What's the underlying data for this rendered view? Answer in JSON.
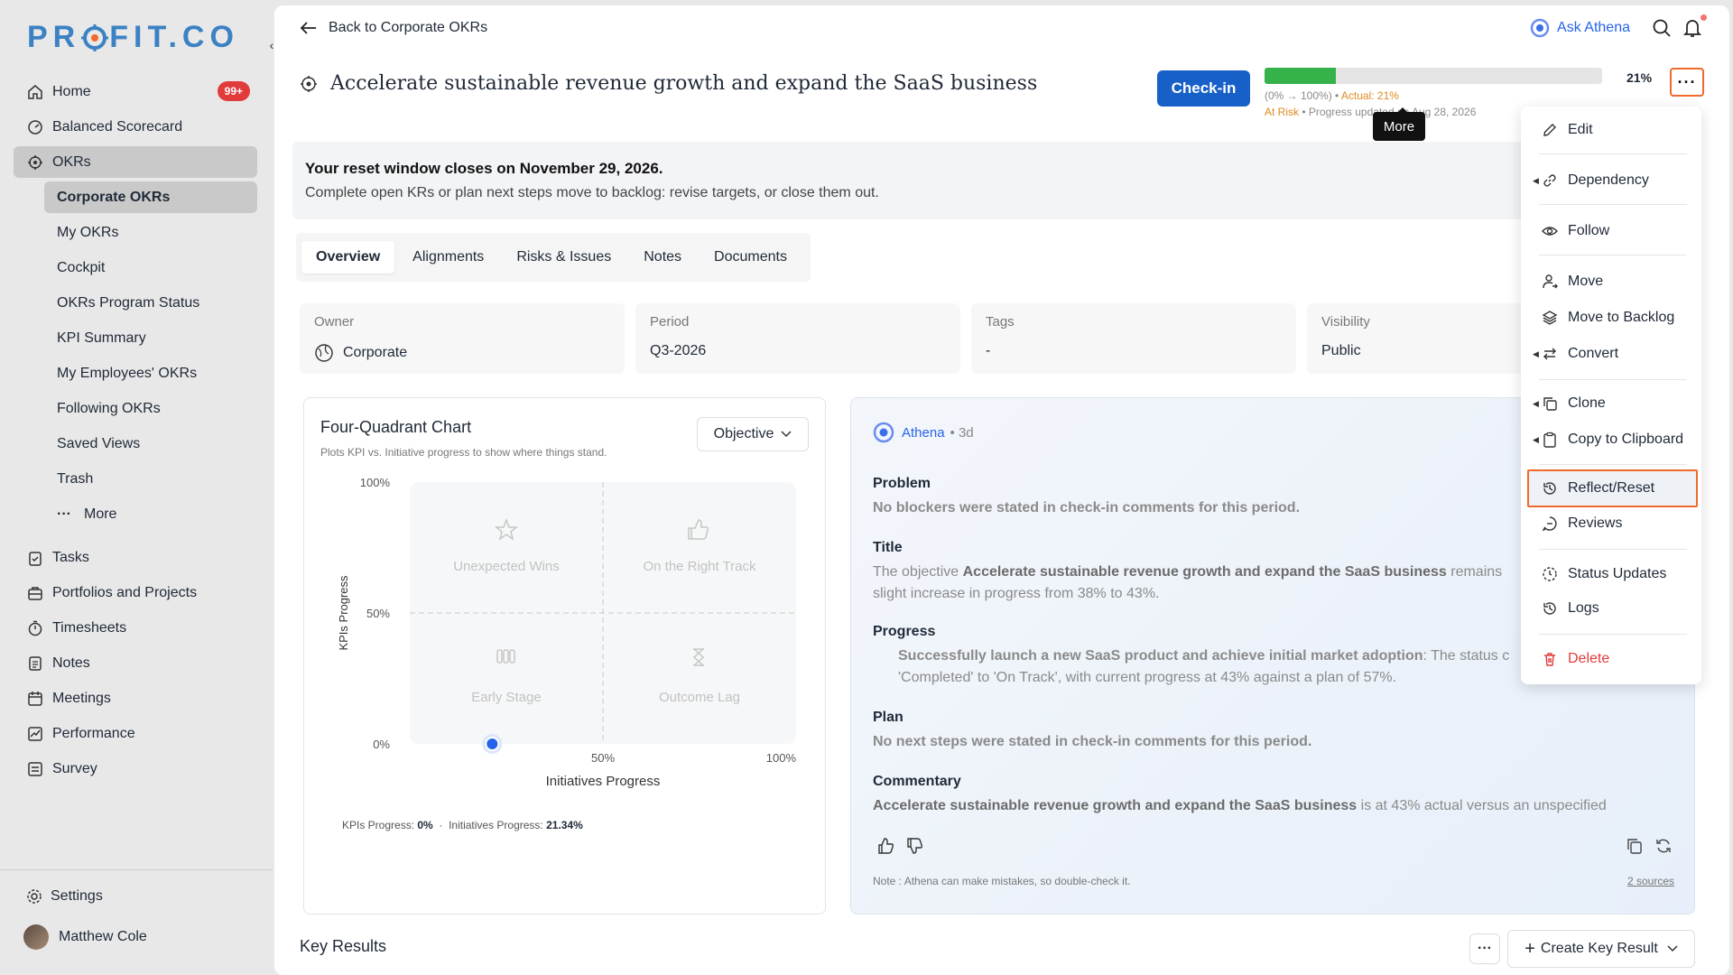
{
  "sidebar": {
    "logo": "PROFIT.CO",
    "collapse_icon": "chevron-left-icon",
    "home": {
      "label": "Home",
      "badge": "99+"
    },
    "balanced": "Balanced Scorecard",
    "okrs": "OKRs",
    "sub_items": [
      "Corporate OKRs",
      "My OKRs",
      "Cockpit",
      "OKRs Program Status",
      "KPI Summary",
      "My Employees' OKRs",
      "Following OKRs",
      "Saved Views",
      "Trash"
    ],
    "more": "More",
    "tasks": "Tasks",
    "portfolios": "Portfolios and Projects",
    "timesheets": "Timesheets",
    "notes": "Notes",
    "meetings": "Meetings",
    "performance": "Performance",
    "survey": "Survey",
    "settings": "Settings",
    "user": "Matthew Cole"
  },
  "header": {
    "back": "Back to Corporate OKRs",
    "ask": "Ask Athena",
    "title": "Accelerate sustainable revenue growth and expand the SaaS business",
    "checkin": "Check-in",
    "progress_pct": "21%",
    "progress_value": 0.21,
    "range": "(0% → 100%) •",
    "actual": "Actual: 21%",
    "status": "At Risk",
    "updated": "• Progress updated on Aug 28, 2026",
    "more_tooltip": "More"
  },
  "banner": {
    "title": "Your reset window closes on November 29, 2026.",
    "subtitle": "Complete open KRs or plan next steps move to backlog: revise targets, or close them out."
  },
  "tabs": [
    "Overview",
    "Alignments",
    "Risks & Issues",
    "Notes",
    "Documents"
  ],
  "info": {
    "owner_label": "Owner",
    "owner": "Corporate",
    "period_label": "Period",
    "period": "Q3-2026",
    "tags_label": "Tags",
    "tags": "-",
    "visibility_label": "Visibility",
    "visibility": "Public"
  },
  "chart": {
    "title": "Four-Quadrant Chart",
    "subtitle": "Plots KPI vs. Initiative progress to show where things stand.",
    "select": "Objective",
    "ylabel": "KPIs Progress",
    "xlabel": "Initiatives Progress",
    "yticks": [
      "100%",
      "50%",
      "0%"
    ],
    "xticks": [
      "50%",
      "100%"
    ],
    "quadrants": [
      "Unexpected Wins",
      "On the Right Track",
      "Early Stage",
      "Outcome Lag"
    ],
    "foot_kpi_label": "KPIs Progress:",
    "foot_kpi": "0%",
    "foot_init_label": "Initiatives Progress:",
    "foot_init": "21.34%"
  },
  "chart_data": {
    "type": "scatter",
    "title": "Four-Quadrant Chart",
    "xlabel": "Initiatives Progress",
    "ylabel": "KPIs Progress",
    "xlim": [
      0,
      100
    ],
    "ylim": [
      0,
      100
    ],
    "quadrant_labels": [
      "Unexpected Wins",
      "On the Right Track",
      "Early Stage",
      "Outcome Lag"
    ],
    "points": [
      {
        "x": 21.34,
        "y": 0
      }
    ]
  },
  "athena": {
    "name": "Athena",
    "time": "• 3d",
    "problem_h": "Problem",
    "problem": "No blockers were stated in check-in comments for this period.",
    "title_h": "Title",
    "title_pre": "The objective ",
    "title_bold": "Accelerate sustainable revenue growth and expand the SaaS business",
    "title_post": " remains",
    "title_line2": "slight increase in progress from 38% to 43%.",
    "progress_h": "Progress",
    "progress_bold": "Successfully launch a new SaaS product and achieve initial market adoption",
    "progress_post": ": The status c",
    "progress_line2": "'Completed' to 'On Track', with current progress at 43% against a plan of 57%.",
    "plan_h": "Plan",
    "plan": "No next steps were stated in check-in comments for this period.",
    "commentary_h": "Commentary",
    "commentary_bold": "Accelerate sustainable revenue growth and expand the SaaS business",
    "commentary_post": " is at 43% actual versus an unspecified",
    "note": "Note : Athena can make mistakes, so double-check it.",
    "sources": "2 sources"
  },
  "key_results": {
    "title": "Key Results",
    "create": "Create Key Result"
  },
  "menu": {
    "edit": "Edit",
    "dependency": "Dependency",
    "follow": "Follow",
    "move": "Move",
    "backlog": "Move to Backlog",
    "convert": "Convert",
    "clone": "Clone",
    "copy": "Copy to Clipboard",
    "reflect": "Reflect/Reset",
    "reviews": "Reviews",
    "status": "Status Updates",
    "logs": "Logs",
    "delete": "Delete"
  }
}
